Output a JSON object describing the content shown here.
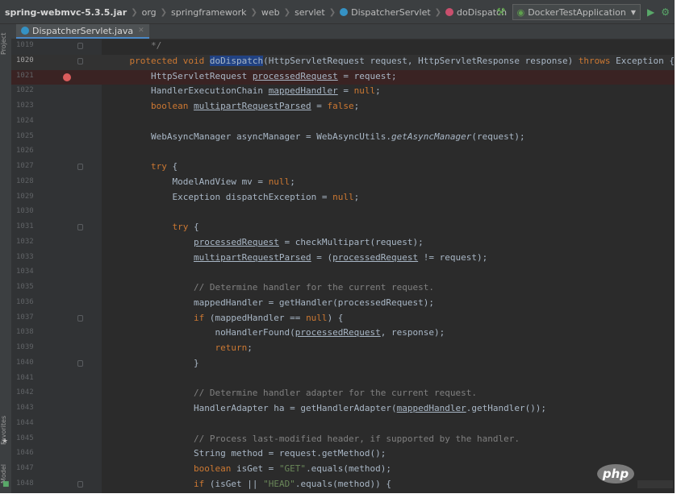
{
  "breadcrumbs": [
    {
      "label": "spring-webmvc-5.3.5.jar",
      "kind": "jar",
      "icon": null
    },
    {
      "label": "org",
      "kind": "pkg",
      "icon": null
    },
    {
      "label": "springframework",
      "kind": "pkg",
      "icon": null
    },
    {
      "label": "web",
      "kind": "pkg",
      "icon": null
    },
    {
      "label": "servlet",
      "kind": "pkg",
      "icon": null
    },
    {
      "label": "DispatcherServlet",
      "kind": "class",
      "icon": "class-icon"
    },
    {
      "label": "doDispatch",
      "kind": "method",
      "icon": "method-icon"
    }
  ],
  "toolbar": {
    "run_config": "DockerTestApplication",
    "icons": [
      "hammer-icon",
      "run-config-icon",
      "chevron-down-icon",
      "run-icon",
      "debug-icon"
    ]
  },
  "tool_windows": {
    "project": "Project",
    "favorites": "Favorites",
    "structure": "Model"
  },
  "tab": {
    "label": "DispatcherServlet.java"
  },
  "colors": {
    "keyword": "#cc7832",
    "string": "#6a8759",
    "comment": "#808080",
    "text": "#a9b7c6",
    "breakpoint": "#db5c5c",
    "selection": "#214283"
  },
  "editor": {
    "lines": [
      {
        "num": "1019",
        "fold": true,
        "tokens": [
          {
            "t": "        */",
            "c": "cm"
          }
        ]
      },
      {
        "num": "1020",
        "current": true,
        "fold": true,
        "tokens": [
          {
            "t": "    protected void ",
            "c": "kw"
          },
          {
            "t": "doDispatch",
            "c": "hl"
          },
          {
            "t": "(HttpServletRequest request, HttpServletResponse response) "
          },
          {
            "t": "throws",
            "c": "kw"
          },
          {
            "t": " Exception {"
          }
        ]
      },
      {
        "num": "1021",
        "breakpoint": true,
        "tokens": [
          {
            "t": "        HttpServletRequest "
          },
          {
            "t": "processedRequest",
            "c": "ul"
          },
          {
            "t": " = request;"
          }
        ]
      },
      {
        "num": "1022",
        "tokens": [
          {
            "t": "        HandlerExecutionChain "
          },
          {
            "t": "mappedHandler",
            "c": "ul"
          },
          {
            "t": " = "
          },
          {
            "t": "null",
            "c": "kw"
          },
          {
            "t": ";"
          }
        ]
      },
      {
        "num": "1023",
        "tokens": [
          {
            "t": "        boolean ",
            "c": "kw"
          },
          {
            "t": "multipartRequestParsed",
            "c": "ul"
          },
          {
            "t": " = "
          },
          {
            "t": "false",
            "c": "kw"
          },
          {
            "t": ";"
          }
        ]
      },
      {
        "num": "1024",
        "tokens": []
      },
      {
        "num": "1025",
        "tokens": [
          {
            "t": "        WebAsyncManager asyncManager = WebAsyncUtils."
          },
          {
            "t": "getAsyncManager",
            "c": "it"
          },
          {
            "t": "(request);"
          }
        ]
      },
      {
        "num": "1026",
        "tokens": []
      },
      {
        "num": "1027",
        "fold": true,
        "tokens": [
          {
            "t": "        try",
            "c": "kw"
          },
          {
            "t": " {"
          }
        ]
      },
      {
        "num": "1028",
        "tokens": [
          {
            "t": "            ModelAndView mv = "
          },
          {
            "t": "null",
            "c": "kw"
          },
          {
            "t": ";"
          }
        ]
      },
      {
        "num": "1029",
        "tokens": [
          {
            "t": "            Exception dispatchException = "
          },
          {
            "t": "null",
            "c": "kw"
          },
          {
            "t": ";"
          }
        ]
      },
      {
        "num": "1030",
        "tokens": []
      },
      {
        "num": "1031",
        "fold": true,
        "tokens": [
          {
            "t": "            try",
            "c": "kw"
          },
          {
            "t": " {"
          }
        ]
      },
      {
        "num": "1032",
        "tokens": [
          {
            "t": "                "
          },
          {
            "t": "processedRequest",
            "c": "ul"
          },
          {
            "t": " = checkMultipart(request);"
          }
        ]
      },
      {
        "num": "1033",
        "tokens": [
          {
            "t": "                "
          },
          {
            "t": "multipartRequestParsed",
            "c": "ul"
          },
          {
            "t": " = ("
          },
          {
            "t": "processedRequest",
            "c": "ul"
          },
          {
            "t": " != request);"
          }
        ]
      },
      {
        "num": "1034",
        "tokens": []
      },
      {
        "num": "1035",
        "tokens": [
          {
            "t": "                // Determine handler for the current request.",
            "c": "cm"
          }
        ]
      },
      {
        "num": "1036",
        "tokens": [
          {
            "t": "                mappedHandler = getHandler(processedRequest);"
          }
        ]
      },
      {
        "num": "1037",
        "fold": true,
        "tokens": [
          {
            "t": "                if",
            "c": "kw"
          },
          {
            "t": " (mappedHandler == "
          },
          {
            "t": "null",
            "c": "kw"
          },
          {
            "t": ") {"
          }
        ]
      },
      {
        "num": "1038",
        "tokens": [
          {
            "t": "                    noHandlerFound("
          },
          {
            "t": "processedRequest",
            "c": "ul"
          },
          {
            "t": ", response);"
          }
        ]
      },
      {
        "num": "1039",
        "tokens": [
          {
            "t": "                    return",
            "c": "kw"
          },
          {
            "t": ";"
          }
        ]
      },
      {
        "num": "1040",
        "fold": true,
        "tokens": [
          {
            "t": "                }"
          }
        ]
      },
      {
        "num": "1041",
        "tokens": []
      },
      {
        "num": "1042",
        "tokens": [
          {
            "t": "                // Determine handler adapter for the current request.",
            "c": "cm"
          }
        ]
      },
      {
        "num": "1043",
        "tokens": [
          {
            "t": "                HandlerAdapter ha = getHandlerAdapter("
          },
          {
            "t": "mappedHandler",
            "c": "ul"
          },
          {
            "t": ".getHandler());"
          }
        ]
      },
      {
        "num": "1044",
        "tokens": []
      },
      {
        "num": "1045",
        "tokens": [
          {
            "t": "                // Process last-modified header, if supported by the handler.",
            "c": "cm"
          }
        ]
      },
      {
        "num": "1046",
        "tokens": [
          {
            "t": "                String method = request.getMethod();"
          }
        ]
      },
      {
        "num": "1047",
        "tokens": [
          {
            "t": "                boolean",
            "c": "kw"
          },
          {
            "t": " isGet = "
          },
          {
            "t": "\"GET\"",
            "c": "str"
          },
          {
            "t": ".equals(method);"
          }
        ]
      },
      {
        "num": "1048",
        "fold": true,
        "tokens": [
          {
            "t": "                if",
            "c": "kw"
          },
          {
            "t": " (isGet || "
          },
          {
            "t": "\"HEAD\"",
            "c": "str"
          },
          {
            "t": ".equals(method)) {"
          }
        ]
      }
    ]
  },
  "watermark": {
    "text": "php"
  }
}
